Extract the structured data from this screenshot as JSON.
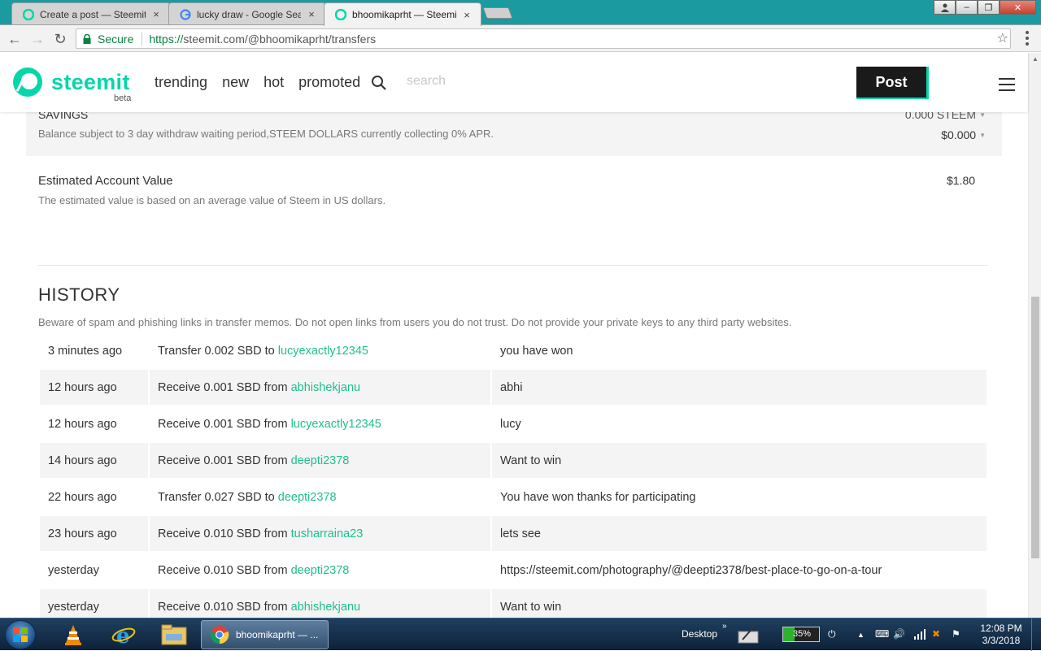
{
  "browser": {
    "tabs": [
      {
        "title": "Create a post — Steemit",
        "close": "×"
      },
      {
        "title": "lucky draw - Google Search",
        "close": "×"
      },
      {
        "title": "bhoomikaprht — Steemit",
        "close": "×"
      }
    ],
    "window_controls": {
      "minimize": "–",
      "maximize": "❐",
      "close": "✕"
    },
    "address": {
      "secure_label": "Secure",
      "url_protocol": "https://",
      "url_rest": "steemit.com/@bhoomikaprht/transfers"
    },
    "nav": {
      "back": "←",
      "forward": "→",
      "reload": "↻",
      "bookmark": "☆"
    }
  },
  "header": {
    "logo_text": "steemit",
    "beta": "beta",
    "links": [
      "trending",
      "new",
      "hot",
      "promoted"
    ],
    "search_placeholder": "search",
    "post_label": "Post"
  },
  "savings": {
    "title": "SAVINGS",
    "description": "Balance subject to 3 day withdraw waiting period,STEEM DOLLARS currently collecting 0% APR.",
    "steem_value": "0.000 STEEM",
    "sbd_value": "$0.000"
  },
  "estimated": {
    "title": "Estimated Account Value",
    "description": "The estimated value is based on an average value of Steem in US dollars.",
    "value": "$1.80"
  },
  "history": {
    "title": "HISTORY",
    "warning": "Beware of spam and phishing links in transfer memos. Do not open links from users you do not trust. Do not provide your private keys to any third party websites.",
    "rows": [
      {
        "time": "3 minutes ago",
        "action": "Transfer 0.002 SBD to ",
        "user": "lucyexactly12345",
        "memo": "you have won"
      },
      {
        "time": "12 hours ago",
        "action": "Receive 0.001 SBD from ",
        "user": "abhishekjanu",
        "memo": "abhi"
      },
      {
        "time": "12 hours ago",
        "action": "Receive 0.001 SBD from ",
        "user": "lucyexactly12345",
        "memo": "lucy"
      },
      {
        "time": "14 hours ago",
        "action": "Receive 0.001 SBD from ",
        "user": "deepti2378",
        "memo": "Want to win"
      },
      {
        "time": "22 hours ago",
        "action": "Transfer 0.027 SBD to ",
        "user": "deepti2378",
        "memo": "You have won thanks for participating"
      },
      {
        "time": "23 hours ago",
        "action": "Receive 0.010 SBD from ",
        "user": "tusharraina23",
        "memo": "lets see"
      },
      {
        "time": "yesterday",
        "action": "Receive 0.010 SBD from ",
        "user": "deepti2378",
        "memo": "https://steemit.com/photography/@deepti2378/best-place-to-go-on-a-tour"
      },
      {
        "time": "yesterday",
        "action": "Receive 0.010 SBD from ",
        "user": "abhishekjanu",
        "memo": "Want to win"
      }
    ]
  },
  "taskbar": {
    "chrome_label": "bhoomikaprht — ...",
    "desktop_label": "Desktop",
    "battery_percent": "35%",
    "time": "12:08 PM",
    "date": "3/3/2018"
  },
  "colors": {
    "steemit_green": "#06d6a9",
    "link_green": "#1fbf8f",
    "post_button": "#1a1a1a"
  }
}
